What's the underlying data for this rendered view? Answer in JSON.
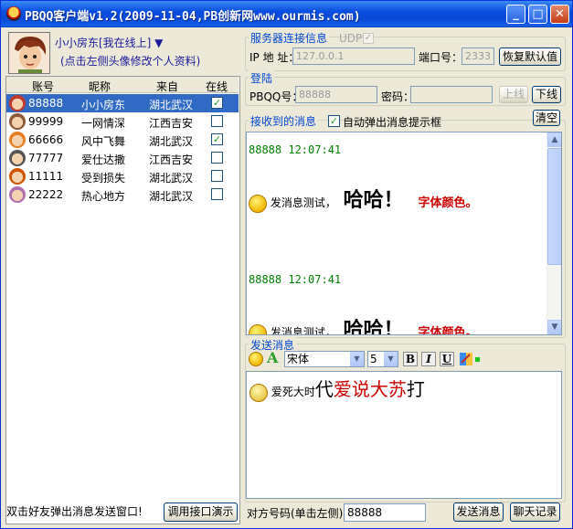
{
  "window": {
    "title": "PBQQ客户端v1.2(2009-11-04,PB创新网www.ourmis.com)",
    "minimize": "_",
    "maximize": "□",
    "close": "✕"
  },
  "user": {
    "name": "小小房东[我在线上] ▼",
    "hint": "(点击左侧头像修改个人资料)"
  },
  "friends": {
    "columns": [
      "账号",
      "昵称",
      "来自",
      "在线"
    ],
    "rows": [
      {
        "id": "88888",
        "nick": "小小房东",
        "from": "湖北武汉",
        "online": true,
        "selected": true,
        "icon_color": "#c0392b"
      },
      {
        "id": "99999",
        "nick": "一网情深",
        "from": "江西吉安",
        "online": false,
        "selected": false,
        "icon_color": "#8e5a3a"
      },
      {
        "id": "66666",
        "nick": "风中飞舞",
        "from": "湖北武汉",
        "online": true,
        "selected": false,
        "icon_color": "#e67e22"
      },
      {
        "id": "77777",
        "nick": "爱仕达撒",
        "from": "江西吉安",
        "online": false,
        "selected": false,
        "icon_color": "#555555"
      },
      {
        "id": "11111",
        "nick": "受到损失",
        "from": "湖北武汉",
        "online": false,
        "selected": false,
        "icon_color": "#d35400"
      },
      {
        "id": "22222",
        "nick": "热心地方",
        "from": "湖北武汉",
        "online": false,
        "selected": false,
        "icon_color": "#b06fb0"
      }
    ],
    "check_mark": "✓"
  },
  "left_footer": {
    "hint": "双击好友弹出消息发送窗口!",
    "api_button": "调用接口演示"
  },
  "server": {
    "legend": "服务器连接信息",
    "udp_label": "UDP",
    "ip_label": "IP 地 址：",
    "ip_value": "127.0.0.1",
    "port_label": "端口号：",
    "port_value": "2333",
    "reset_button": "恢复默认值"
  },
  "login": {
    "legend": "登陆",
    "qq_label": "PBQQ号：",
    "qq_value": "88888",
    "pwd_label": "密码：",
    "login_button": "上线",
    "logout_button": "下线"
  },
  "received": {
    "legend": "接收到的消息",
    "auto_popup_label": "自动弹出消息提示框",
    "clear_button": "清空",
    "messages": [
      {
        "header": "88888  12:07:41",
        "small": "发消息测试，",
        "big": "哈哈！",
        "red": "字体颜色。"
      },
      {
        "header": "88888  12:07:41",
        "small": "发消息测试，",
        "big": "哈哈！",
        "red": "字体颜色。"
      }
    ]
  },
  "send": {
    "legend": "发送消息",
    "font_name": "宋体",
    "font_size": "5",
    "bold": "B",
    "italic": "I",
    "underline": "U",
    "compose_small": "爱死大时",
    "compose_big": "代",
    "compose_red": "爱说大苏",
    "compose_end": "打"
  },
  "bottom": {
    "target_label": "对方号码(单击左侧)",
    "target_value": "88888",
    "send_button": "发送消息",
    "history_button": "聊天记录"
  },
  "colors": {
    "accent": "#0046d5",
    "selection": "#316ac5",
    "message_header": "#008000",
    "red_text": "#cc0000"
  }
}
